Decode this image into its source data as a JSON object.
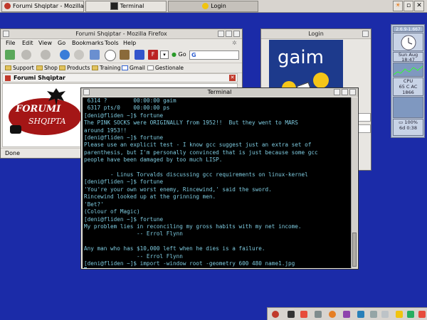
{
  "taskbar": {
    "tasks": [
      {
        "label": "Forumi Shqiptar - Mozilla Firefox"
      },
      {
        "label": "Terminal"
      },
      {
        "label": "Login"
      }
    ]
  },
  "firefox": {
    "title": "Forumi Shqiptar - Mozilla Firefox",
    "menu": [
      "File",
      "Edit",
      "View",
      "Go",
      "Bookmarks",
      "Tools",
      "Help"
    ],
    "go_label": "Go",
    "search_value": "G",
    "bookmarks": [
      "Support",
      "Shop",
      "Products",
      "Training",
      "Gmail",
      "Gestionale"
    ],
    "tab_title": "Forumi Shqiptar",
    "status": "Done",
    "logo_text_1": "FORUMI",
    "logo_text_2": "SHQIPTA"
  },
  "gaim": {
    "title": "Login",
    "logo_text": "gaim"
  },
  "terminal": {
    "title": "Terminal",
    "lines": [
      " 6314 ?        00:00:00 gaim",
      " 6317 pts/0    00:00:00 ps",
      "[deni@fliden ~]$ fortune",
      "The PINK SOCKS were ORIGINALLY from 1952!!  But they went to MARS",
      "around 1953!!",
      "[deni@fliden ~]$ fortune",
      "Please use an explicit test - I know gcc suggest just an extra set of",
      "parenthesis, but I'm personally convinced that is just because some gcc",
      "people have been damaged by too much LISP.",
      "",
      "        - Linus Torvalds discussing gcc requirements on linux-kernel",
      "[deni@fliden ~]$ fortune",
      "'You're your own worst enemy, Rincewind,' said the sword.",
      "Rincewind looked up at the grinning men.",
      "'Bet?'",
      "(Colour of Magic)",
      "[deni@fliden ~]$ fortune",
      "My problem lies in reconciling my gross habits with my net income.",
      "                -- Errol Flynn",
      "",
      "Any man who has $10,000 left when he dies is a failure.",
      "                -- Errol Flynn",
      "[deni@fliden ~]$ import -window root -geometry 600 480 name1.jpg"
    ]
  },
  "dock": {
    "load": "2.6.9-1.667",
    "day": "Sun",
    "date": "Aug",
    "time": "18:47",
    "cpu": "CPU",
    "temp": "65 C",
    "ac": "AC",
    "freq": "1866",
    "battery": "100%",
    "batt_time": "6d",
    "batt_time2": "0:38"
  },
  "colors": {
    "desktop": "#1b2ba8",
    "terminal_bg": "#000000",
    "terminal_fg": "#7ecbe0"
  }
}
